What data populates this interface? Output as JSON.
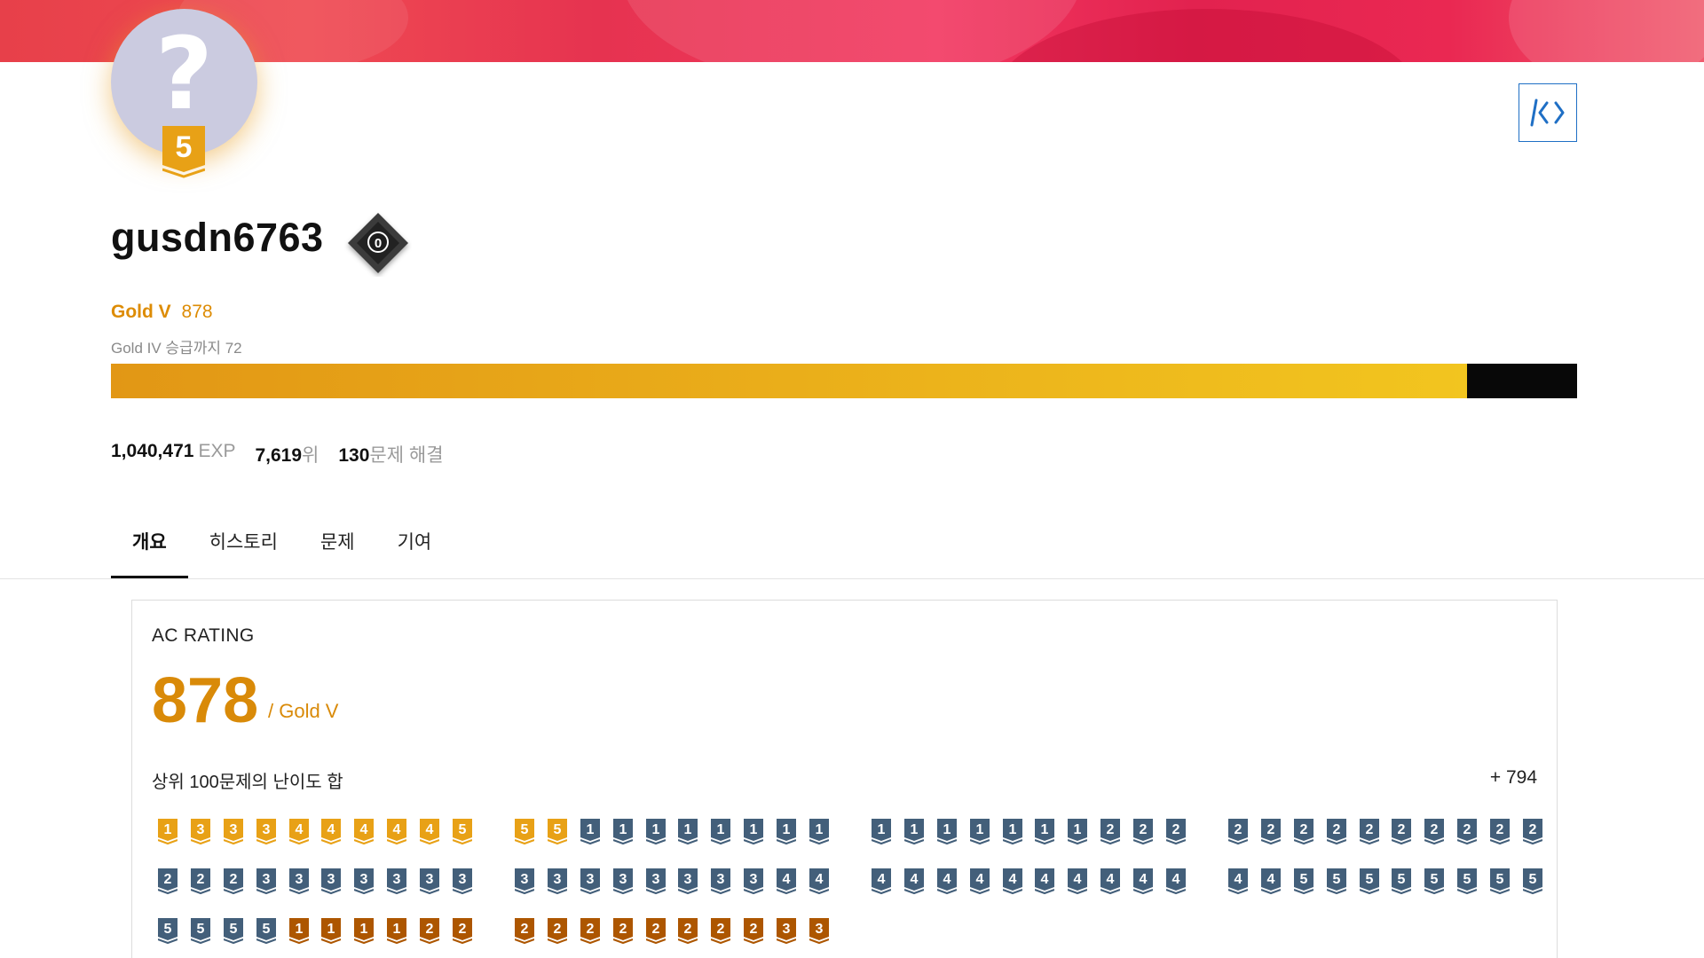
{
  "profile": {
    "username": "gusdn6763",
    "avatar_glyph": "?",
    "avatar_tier_number": "5",
    "class_badge_number": "0",
    "tier_name": "Gold V",
    "rating": "878",
    "promotion_text": "Gold IV 승급까지 72",
    "progress_fraction": 0.925
  },
  "stats": {
    "exp_value": "1,040,471",
    "exp_label": "EXP",
    "rank_value": "7,619",
    "rank_label": "위",
    "solved_value": "130",
    "solved_label": "문제 해결"
  },
  "tabs": [
    {
      "label": "개요",
      "active": true
    },
    {
      "label": "히스토리",
      "active": false
    },
    {
      "label": "문제",
      "active": false
    },
    {
      "label": "기여",
      "active": false
    }
  ],
  "ac_rating": {
    "label": "AC RATING",
    "value": "878",
    "tier_suffix": "/ Gold V",
    "top100_label": "상위 100문제의 난이도 합",
    "top100_value": "+ 794"
  },
  "tiers": {
    "rows": [
      [
        [
          "G1",
          "G3",
          "G3",
          "G3",
          "G4",
          "G4",
          "G4",
          "G4",
          "G4",
          "G5"
        ],
        [
          "G5",
          "G5",
          "S1",
          "S1",
          "S1",
          "S1",
          "S1",
          "S1",
          "S1",
          "S1"
        ],
        [
          "S1",
          "S1",
          "S1",
          "S1",
          "S1",
          "S1",
          "S1",
          "S2",
          "S2",
          "S2"
        ],
        [
          "S2",
          "S2",
          "S2",
          "S2",
          "S2",
          "S2",
          "S2",
          "S2",
          "S2",
          "S2"
        ]
      ],
      [
        [
          "S2",
          "S2",
          "S2",
          "S3",
          "S3",
          "S3",
          "S3",
          "S3",
          "S3",
          "S3"
        ],
        [
          "S3",
          "S3",
          "S3",
          "S3",
          "S3",
          "S3",
          "S3",
          "S3",
          "S4",
          "S4"
        ],
        [
          "S4",
          "S4",
          "S4",
          "S4",
          "S4",
          "S4",
          "S4",
          "S4",
          "S4",
          "S4"
        ],
        [
          "S4",
          "S4",
          "S5",
          "S5",
          "S5",
          "S5",
          "S5",
          "S5",
          "S5",
          "S5"
        ]
      ],
      [
        [
          "S5",
          "S5",
          "S5",
          "S5",
          "B1",
          "B1",
          "B1",
          "B1",
          "B2",
          "B2"
        ],
        [
          "B2",
          "B2",
          "B2",
          "B2",
          "B2",
          "B2",
          "B2",
          "B2",
          "B3",
          "B3"
        ]
      ]
    ]
  },
  "colors": {
    "gold": "#e8a116",
    "gold_text": "#dd8c05",
    "silver": "#435f7a",
    "bronze": "#ad5600",
    "code_button": "#1f6fc5"
  },
  "icons": {
    "code_button": "code-bracket-icon",
    "class_badge": "class-diamond-icon"
  }
}
